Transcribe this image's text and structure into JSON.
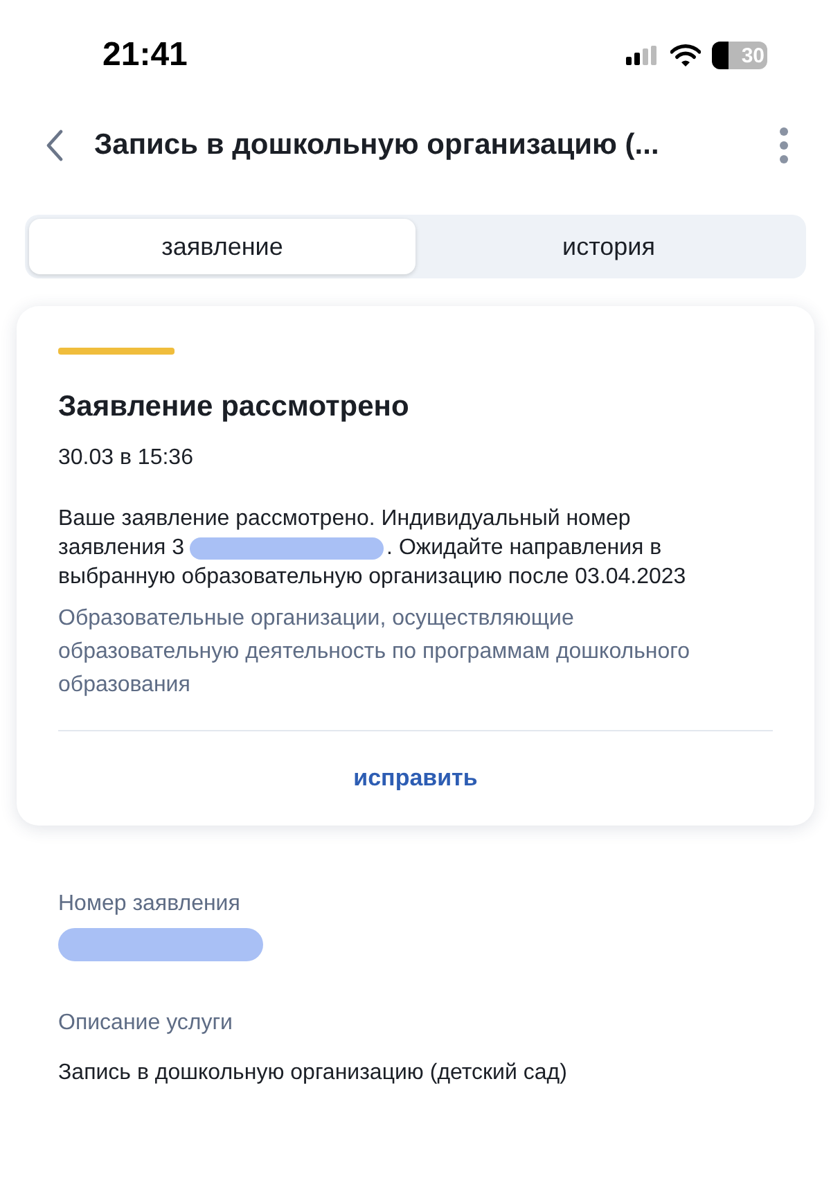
{
  "status_bar": {
    "time": "21:41",
    "battery": "30"
  },
  "header": {
    "title": "Запись в дошкольную организацию (..."
  },
  "tabs": [
    {
      "label": "заявление",
      "selected": true
    },
    {
      "label": "история",
      "selected": false
    }
  ],
  "status_card": {
    "title": "Заявление рассмотрено",
    "date": "30.03 в 15:36",
    "message_lines": [
      "Ваше заявление рассмотрено. Индивидуальный номер",
      "заявления 3",
      ". Ожидайте направления в",
      "выбранную образовательную организацию после 03.04.2023"
    ],
    "organization": "Образовательные организации, осуществляющие образовательную деятельность по программам дошкольного образования",
    "action": "исправить"
  },
  "fields": [
    {
      "label": "Номер заявления",
      "kind": "redacted"
    },
    {
      "label": "Описание услуги",
      "kind": "text",
      "value": "Запись в дошкольную организацию (детский сад)"
    }
  ]
}
